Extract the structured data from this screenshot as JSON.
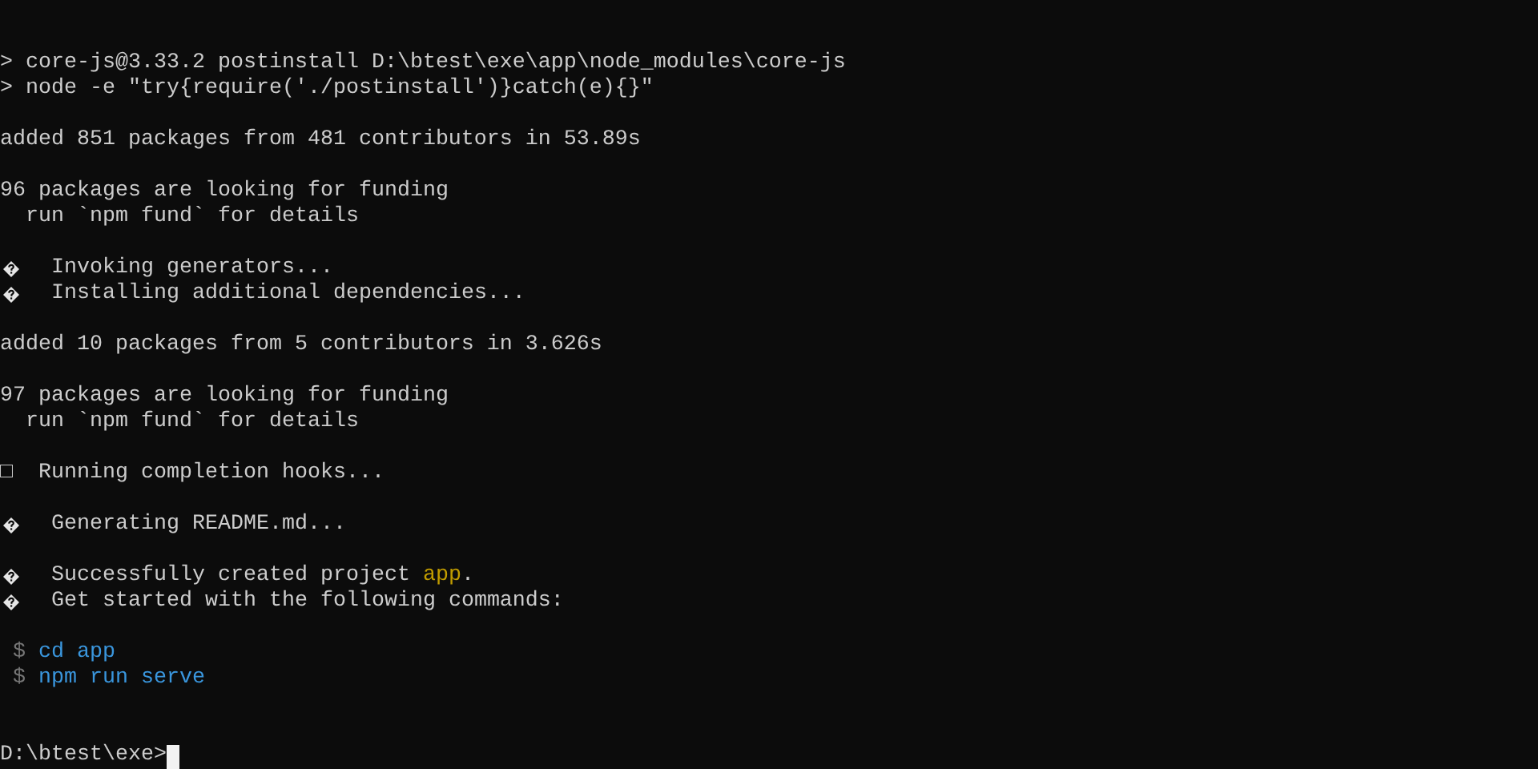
{
  "terminal": {
    "lines": [
      {
        "kind": "text",
        "text": "> core-js@3.33.2 postinstall D:\\btest\\exe\\app\\node_modules\\core-js"
      },
      {
        "kind": "text",
        "text": "> node -e \"try{require('./postinstall')}catch(e){}\""
      },
      {
        "kind": "blank"
      },
      {
        "kind": "text",
        "text": "added 851 packages from 481 contributors in 53.89s"
      },
      {
        "kind": "blank"
      },
      {
        "kind": "text",
        "text": "96 packages are looking for funding"
      },
      {
        "kind": "text",
        "text": "  run `npm fund` for details"
      },
      {
        "kind": "blank"
      },
      {
        "kind": "glyph",
        "text": "Invoking generators..."
      },
      {
        "kind": "glyph",
        "text": "Installing additional dependencies..."
      },
      {
        "kind": "blank"
      },
      {
        "kind": "text",
        "text": "added 10 packages from 5 contributors in 3.626s"
      },
      {
        "kind": "blank"
      },
      {
        "kind": "text",
        "text": "97 packages are looking for funding"
      },
      {
        "kind": "text",
        "text": "  run `npm fund` for details"
      },
      {
        "kind": "blank"
      },
      {
        "kind": "text",
        "text": "□  Running completion hooks..."
      },
      {
        "kind": "blank"
      },
      {
        "kind": "glyph",
        "text": "Generating README.md..."
      },
      {
        "kind": "blank"
      },
      {
        "kind": "glyph",
        "segments": [
          {
            "kind": "text",
            "text": "Successfully created project "
          },
          {
            "kind": "name",
            "text": "app"
          },
          {
            "kind": "text",
            "text": "."
          }
        ]
      },
      {
        "kind": "glyph",
        "text": "Get started with the following commands:"
      },
      {
        "kind": "blank"
      },
      {
        "kind": "mixed",
        "segments": [
          {
            "kind": "sign",
            "text": " $ "
          },
          {
            "kind": "command",
            "text": "cd app"
          }
        ]
      },
      {
        "kind": "mixed",
        "segments": [
          {
            "kind": "sign",
            "text": " $ "
          },
          {
            "kind": "command",
            "text": "npm run serve"
          }
        ]
      },
      {
        "kind": "blank"
      },
      {
        "kind": "blank"
      },
      {
        "kind": "prompt",
        "cursor": true,
        "text": "D:\\btest\\exe>"
      }
    ]
  }
}
